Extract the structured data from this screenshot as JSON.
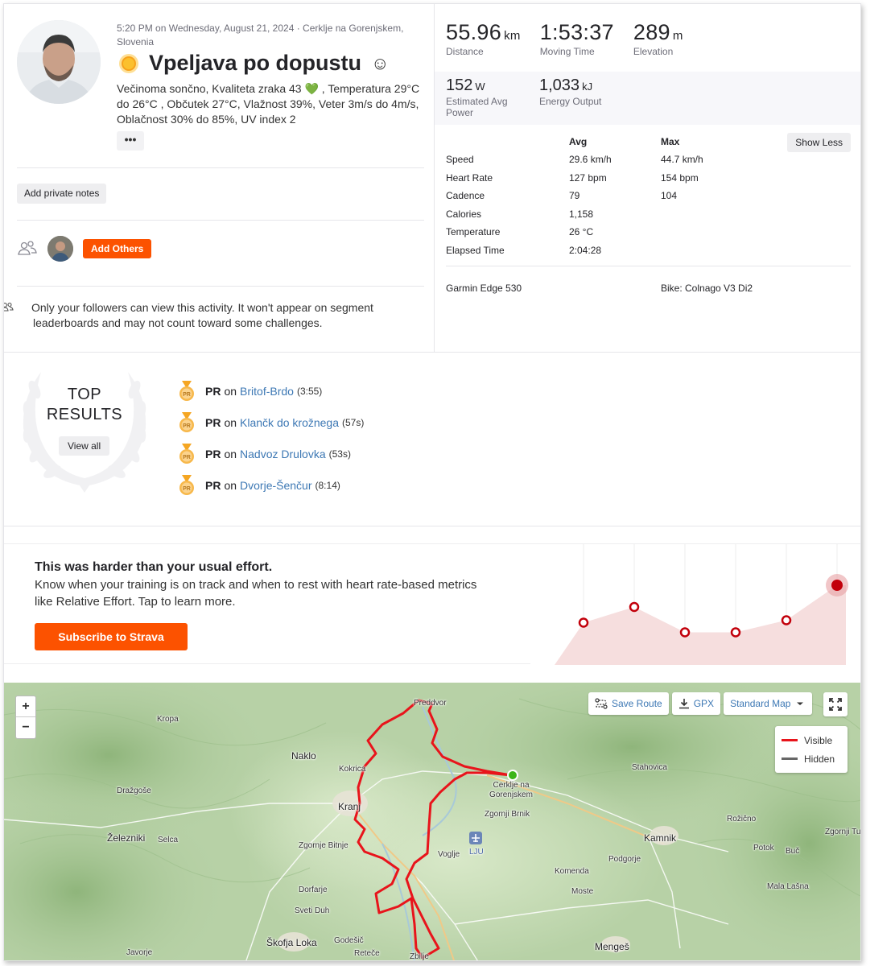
{
  "activity": {
    "meta": "5:20 PM on Wednesday, August 21, 2024 · Cerklje na Gorenjskem, Slovenia",
    "title": "Vpeljava po dopustu",
    "weather": "Večinoma sončno, Kvaliteta zraka 43 💚 , Temperatura 29°C do 26°C , Občutek 27°C, Vlažnost 39%, Veter 3m/s do 4m/s, Oblačnost 30% do 85%, UV index 2",
    "more_label": "•••",
    "private_notes_label": "Add private notes",
    "add_others_label": "Add Others",
    "privacy_note": "Only your followers can view this activity. It won't appear on segment leaderboards and may not count toward some challenges."
  },
  "stats": {
    "big": [
      {
        "value": "55.96",
        "unit": "km",
        "label": "Distance"
      },
      {
        "value": "1:53:37",
        "unit": "",
        "label": "Moving Time"
      },
      {
        "value": "289",
        "unit": "m",
        "label": "Elevation"
      }
    ],
    "small": [
      {
        "value": "152",
        "unit": "W",
        "label": "Estimated Avg Power"
      },
      {
        "value": "1,033",
        "unit": "kJ",
        "label": "Energy Output"
      }
    ],
    "table_headers": [
      "",
      "Avg",
      "Max"
    ],
    "show_less_label": "Show Less",
    "rows": [
      {
        "name": "Speed",
        "avg": "29.6 km/h",
        "max": "44.7 km/h"
      },
      {
        "name": "Heart Rate",
        "avg": "127 bpm",
        "max": "154 bpm"
      },
      {
        "name": "Cadence",
        "avg": "79",
        "max": "104"
      },
      {
        "name": "Calories",
        "avg": "1,158",
        "max": ""
      },
      {
        "name": "Temperature",
        "avg": "26 °C",
        "max": ""
      },
      {
        "name": "Elapsed Time",
        "avg": "2:04:28",
        "max": ""
      }
    ],
    "device": "Garmin Edge 530",
    "bike": "Bike: Colnago V3 Di2"
  },
  "results": {
    "heading_line1": "TOP",
    "heading_line2": "RESULTS",
    "view_all_label": "View all",
    "pr_label": "PR",
    "on_label": "on",
    "items": [
      {
        "segment": "Britof-Brdo",
        "time": "(3:55)"
      },
      {
        "segment": "Klančk do krožnega",
        "time": "(57s)"
      },
      {
        "segment": "Nadvoz Drulovka",
        "time": "(53s)"
      },
      {
        "segment": "Dvorje-Šenčur",
        "time": "(8:14)"
      }
    ]
  },
  "effort": {
    "heading": "This was harder than your usual effort.",
    "body": "Know when your training is on track and when to rest with heart rate-based metrics like Relative Effort. Tap to learn more.",
    "subscribe_label": "Subscribe to Strava"
  },
  "map": {
    "zoom_in": "+",
    "zoom_out": "−",
    "save_route_label": "Save Route",
    "gpx_label": "GPX",
    "map_type_label": "Standard Map",
    "legend_visible": "Visible",
    "legend_hidden": "Hidden",
    "route_color": "#e8141b",
    "labels": {
      "preddvor": "Preddvor",
      "kropa": "Kropa",
      "naklo": "Naklo",
      "kokrica": "Kokrica",
      "cerklje": "Cerklje na Gorenjskem",
      "stahovica": "Stahovica",
      "drazgose": "Dražgoše",
      "kranj": "Kranj",
      "zgornji_brnik": "Zgornji Brnik",
      "rozicno": "Rožično",
      "zelezniki": "Železniki",
      "selca": "Selca",
      "kamnik": "Kamnik",
      "zgornji_tu": "Zgornji Tu",
      "zgornje_bitnje": "Zgornje Bitnje",
      "lju": "LJU",
      "voglje": "Voglje",
      "potok": "Potok",
      "buc": "Buč",
      "podgorje": "Podgorje",
      "komenda": "Komenda",
      "dorfarje": "Dorfarje",
      "moste": "Moste",
      "mala_lasna": "Mala Lašna",
      "sveti_duh": "Sveti Duh",
      "skofja_loka": "Škofja Loka",
      "godesic": "Godešič",
      "mences": "Mengeš",
      "javorje": "Javorje",
      "retece": "Reteče",
      "zbilje": "Zbilje"
    }
  },
  "colors": {
    "brand": "#fc5200",
    "link": "#3d78b4",
    "effort_red": "#c2000b"
  },
  "effort_chart": {
    "points": [
      0.35,
      0.48,
      0.27,
      0.27,
      0.37,
      0.66
    ]
  }
}
